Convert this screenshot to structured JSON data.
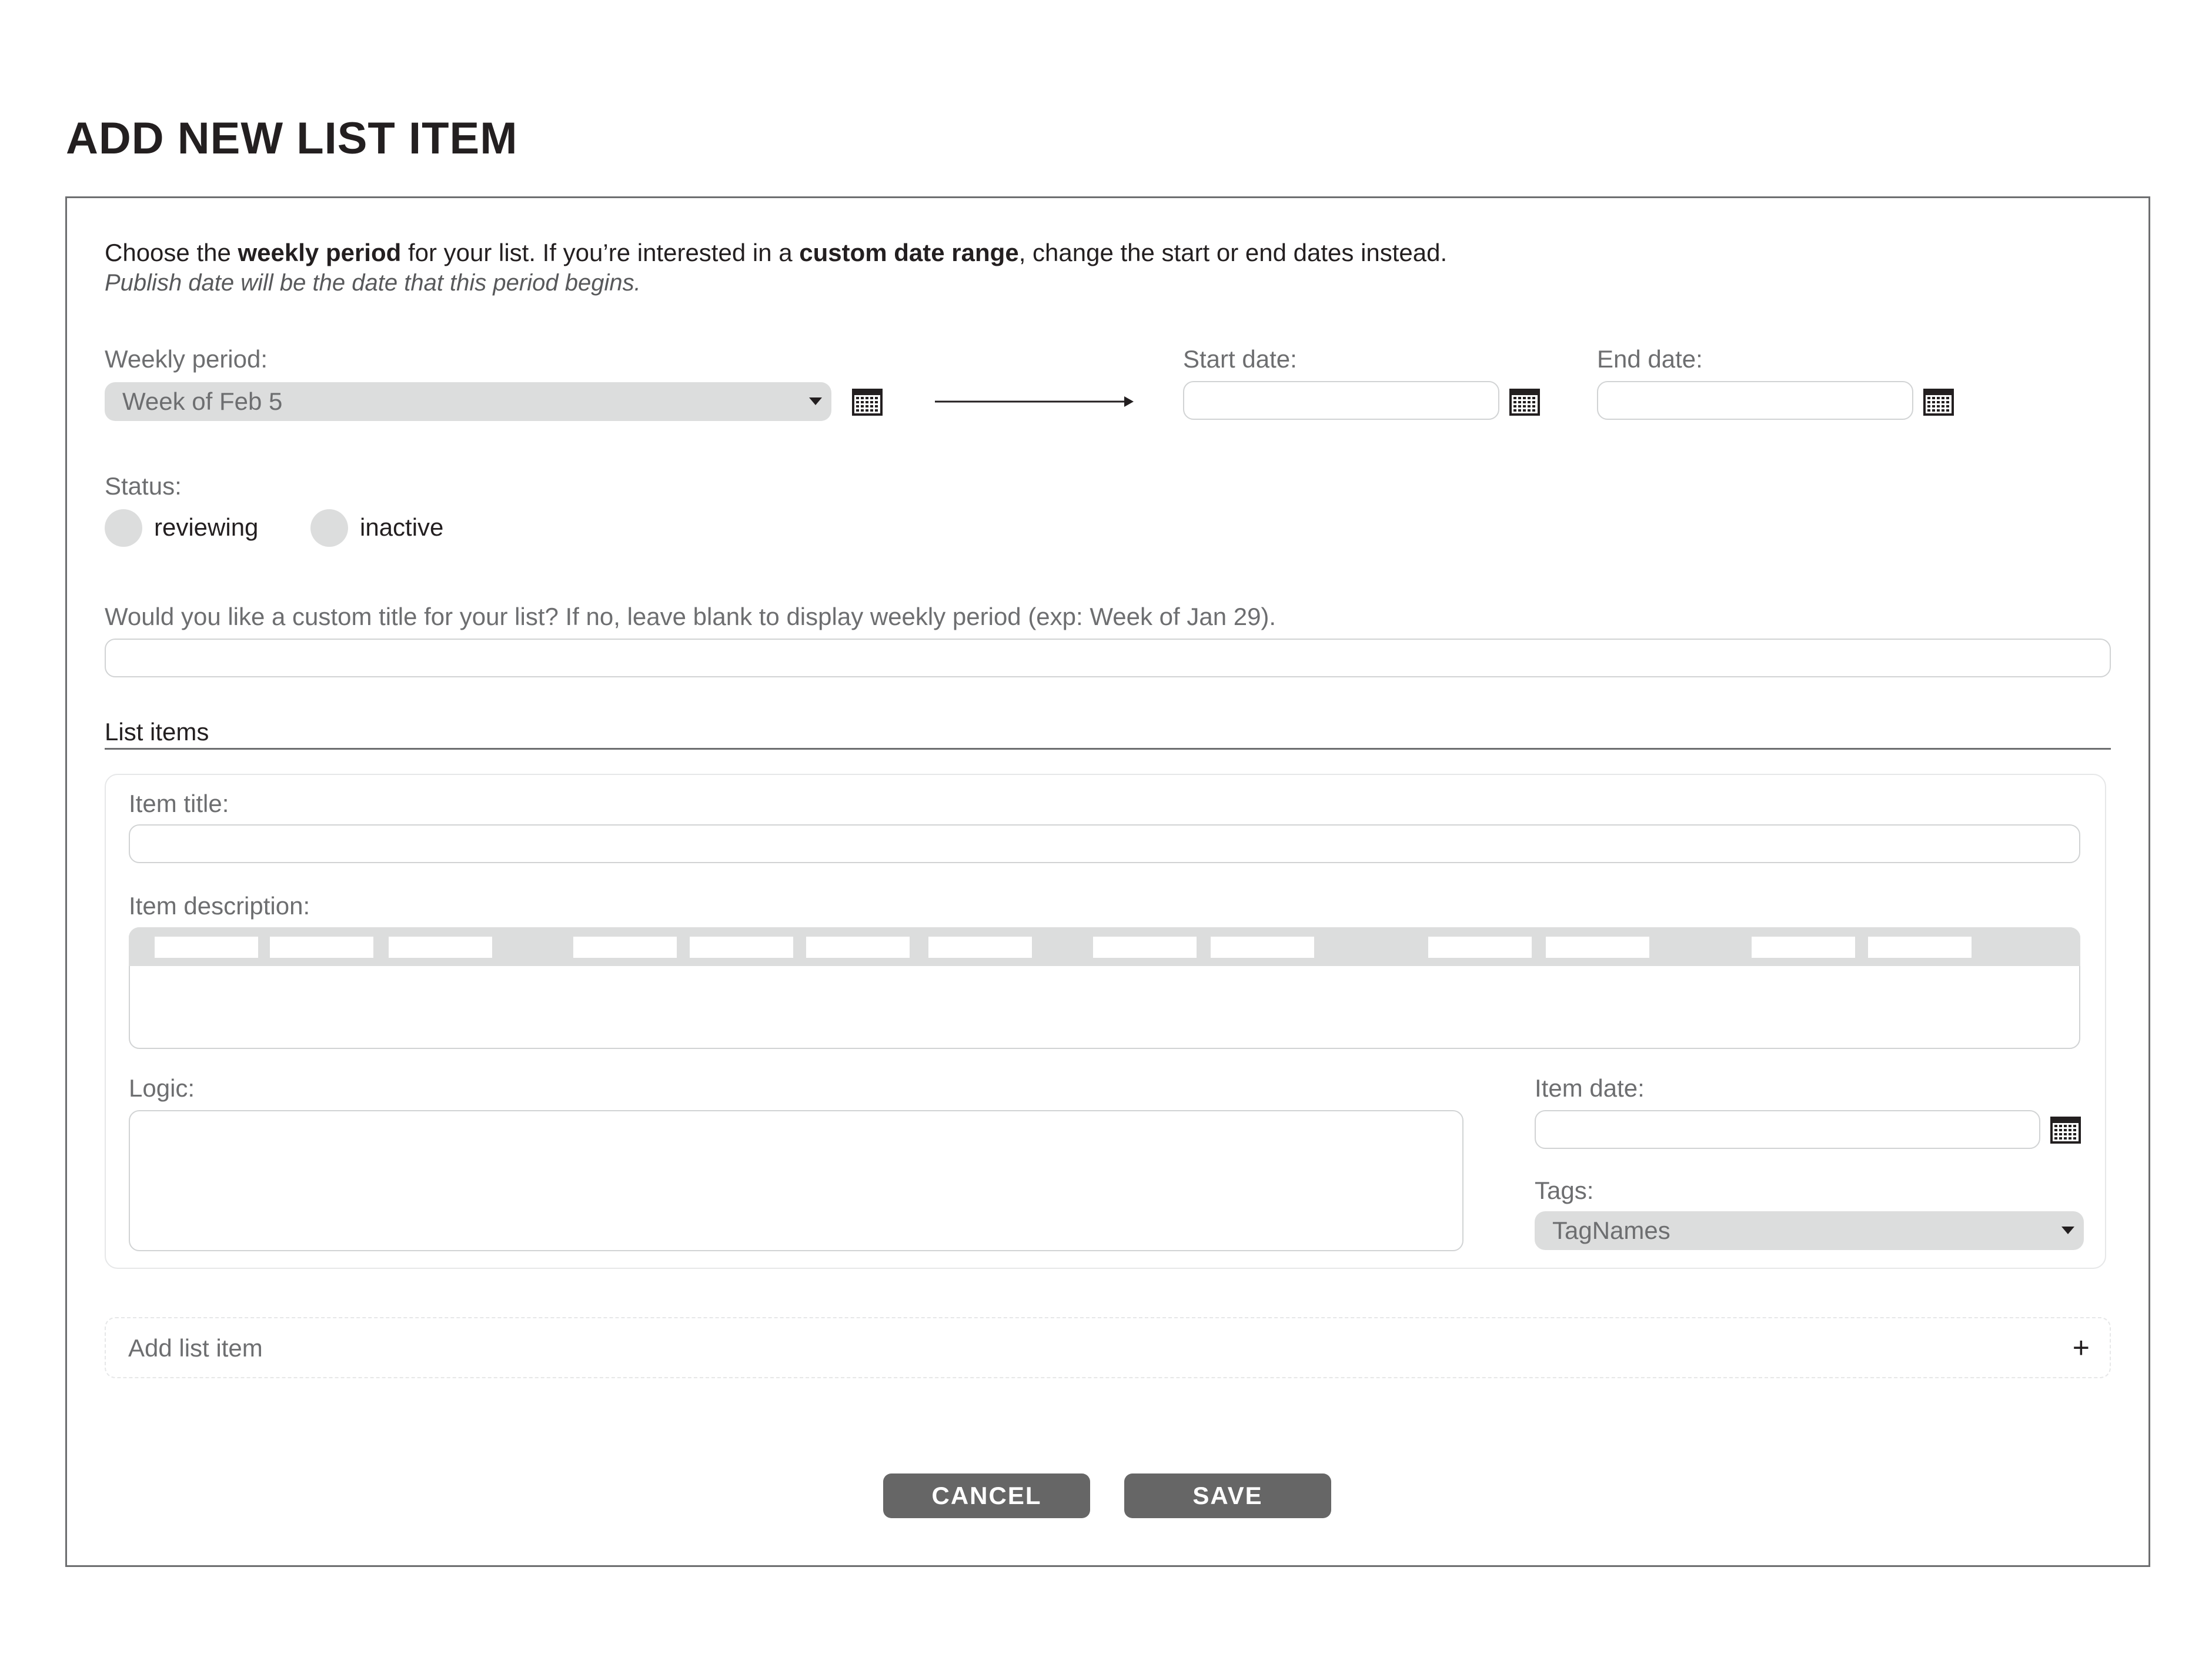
{
  "page": {
    "title": "ADD NEW LIST ITEM"
  },
  "intro": {
    "part1": "Choose the ",
    "bold1": "weekly period",
    "part2": " for your list. If you’re interested in a ",
    "bold2": "custom date range",
    "part3": ", change the start or end dates instead.",
    "note": "Publish date will be the date that this period begins."
  },
  "weekly_period": {
    "label": "Weekly period:",
    "value": "Week of Feb 5"
  },
  "start_date": {
    "label": "Start date:",
    "value": ""
  },
  "end_date": {
    "label": "End date:",
    "value": ""
  },
  "status": {
    "label": "Status:",
    "options": [
      "reviewing",
      "inactive"
    ]
  },
  "custom_title": {
    "label": "Would you like a custom title for your list? If no, leave blank to display weekly period (exp: Week of Jan 29).",
    "value": ""
  },
  "list_items": {
    "heading": "List items",
    "item_title_label": "Item title:",
    "item_description_label": "Item description:",
    "logic_label": "Logic:",
    "item_date_label": "Item date:",
    "tags_label": "Tags:",
    "tags_value": "TagNames"
  },
  "add_item": {
    "label": "Add list item",
    "plus": "+"
  },
  "buttons": {
    "cancel": "CANCEL",
    "save": "SAVE"
  },
  "icons": {
    "calendar": "calendar-icon",
    "arrow": "arrow-right-icon",
    "caret": "chevron-down-icon",
    "plus": "plus-icon"
  },
  "colors": {
    "text": "#231f20",
    "muted": "#6d6e70",
    "select_bg": "#dcdddd",
    "button_bg": "#666666"
  }
}
